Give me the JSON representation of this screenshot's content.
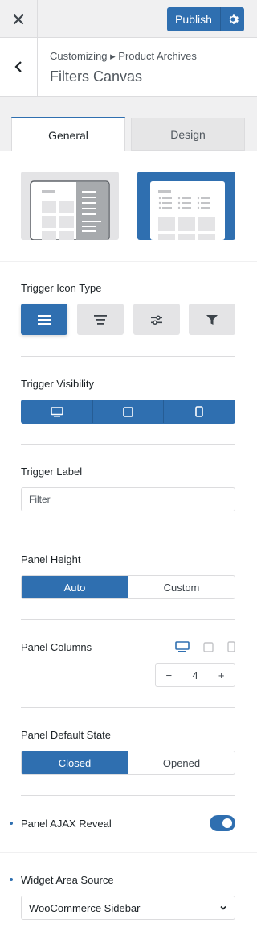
{
  "topbar": {
    "publish_label": "Publish"
  },
  "header": {
    "breadcrumb": "Customizing ▸ Product Archives",
    "title": "Filters Canvas"
  },
  "tabs": [
    {
      "label": "General"
    },
    {
      "label": "Design"
    }
  ],
  "trigger_icon_type": {
    "label": "Trigger Icon Type",
    "options": [
      "menu-icon",
      "menu-lines-icon",
      "sliders-icon",
      "filter-icon"
    ],
    "selected": 0
  },
  "trigger_visibility": {
    "label": "Trigger Visibility",
    "devices": [
      "desktop-icon",
      "tablet-icon",
      "mobile-icon"
    ]
  },
  "trigger_label": {
    "label": "Trigger Label",
    "value": "Filter"
  },
  "panel_height": {
    "label": "Panel Height",
    "options": [
      "Auto",
      "Custom"
    ],
    "selected": "Auto"
  },
  "panel_columns": {
    "label": "Panel Columns",
    "value": "4",
    "minus": "−",
    "plus": "+"
  },
  "panel_default_state": {
    "label": "Panel Default State",
    "options": [
      "Closed",
      "Opened"
    ],
    "selected": "Closed"
  },
  "panel_ajax_reveal": {
    "label": "Panel AJAX Reveal",
    "enabled": true
  },
  "widget_area_source": {
    "label": "Widget Area Source",
    "value": "WooCommerce Sidebar"
  },
  "colors": {
    "accent": "#2f6fb0",
    "background": "#f0f0f1",
    "border": "#dcdcde"
  }
}
